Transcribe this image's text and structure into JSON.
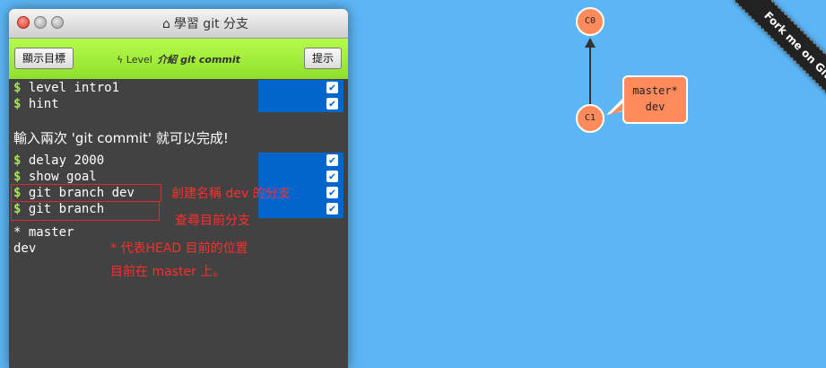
{
  "window": {
    "title": "學習 git 分支",
    "home_icon": "⌂"
  },
  "toolbar": {
    "goal_label": "顯示目標",
    "hint_label": "提示",
    "level_prefix": "Level",
    "level_name": "介紹 git commit",
    "bolt_icon": "ϟ"
  },
  "terminal": {
    "dollar": "$",
    "check": "✔",
    "cmds": [
      "level intro1",
      "hint",
      "delay 2000",
      "show goal",
      "git branch dev",
      "git branch"
    ],
    "message": "輸入兩次 'git commit' 就可以完成!",
    "output": [
      "* master",
      "dev"
    ]
  },
  "annotations": {
    "note1": "創建名稱 dev 的分支",
    "note2": "查尋目前分支",
    "note3": "* 代表HEAD 目前的位置",
    "note4": "目前在 master 上。"
  },
  "visual": {
    "commits": [
      "C0",
      "C1"
    ],
    "branch_label_1": "master*",
    "branch_label_2": "dev"
  },
  "ribbon": {
    "text": "Fork me on GitHub"
  },
  "colors": {
    "background": "#5cb6f5",
    "node": "#ff8a5c",
    "terminal": "#424242",
    "toolbar": "#9ee838",
    "check_bar": "#0066cc",
    "annotation": "#ff2d2d"
  }
}
